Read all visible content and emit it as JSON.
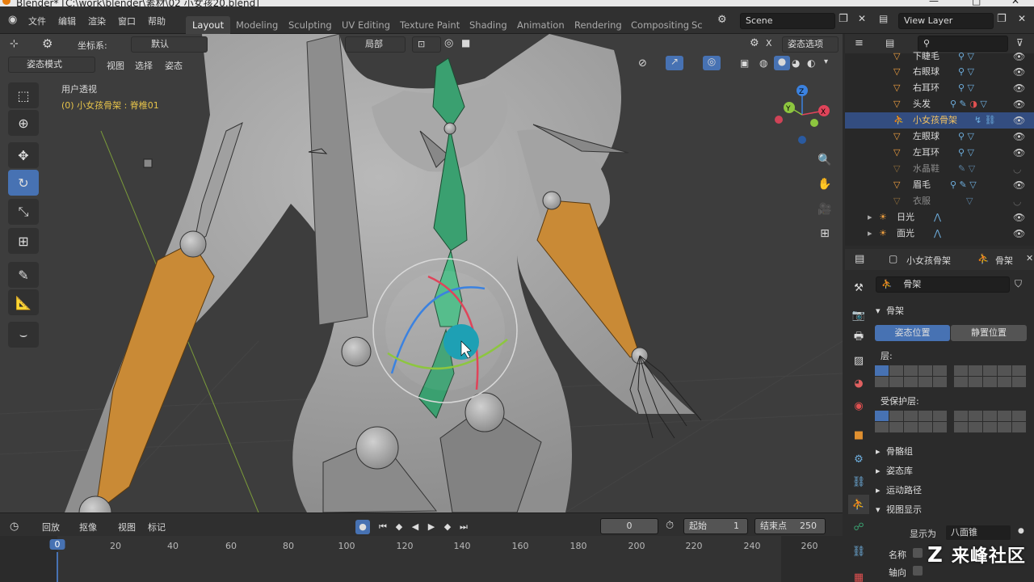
{
  "app": {
    "title": "Blender* [C:\\work\\blender\\素材\\02 小女孩20.blend]",
    "window_controls": [
      "—",
      "□",
      "✕"
    ]
  },
  "menu": [
    "文件",
    "编辑",
    "渲染",
    "窗口",
    "帮助"
  ],
  "workspaces": [
    {
      "label": "Layout",
      "active": true
    },
    {
      "label": "Modeling"
    },
    {
      "label": "Sculpting"
    },
    {
      "label": "UV Editing"
    },
    {
      "label": "Texture Paint"
    },
    {
      "label": "Shading"
    },
    {
      "label": "Animation"
    },
    {
      "label": "Rendering"
    },
    {
      "label": "Compositing"
    },
    {
      "label": "Sc"
    }
  ],
  "scene": {
    "name": "Scene",
    "view_layer": "View Layer"
  },
  "viewport": {
    "coord_label": "坐标系:",
    "coord_value": "默认",
    "pivot": "局部",
    "pose_options": "姿态选项",
    "mode": "姿态模式",
    "menus": [
      "视图",
      "选择",
      "姿态"
    ],
    "view_name": "用户透视",
    "active_info": "(0) 小女孩骨架 : 脊椎01",
    "gizmo_axes": [
      "X",
      "Y",
      "Z"
    ]
  },
  "toolbar": {
    "tools": [
      {
        "icon": "select-box-icon",
        "glyph": "⬚"
      },
      {
        "icon": "cursor-icon",
        "glyph": "⊕"
      },
      {
        "icon": "move-icon",
        "glyph": "✥"
      },
      {
        "icon": "rotate-icon",
        "glyph": "↻",
        "active": true
      },
      {
        "icon": "scale-icon",
        "glyph": "⤡"
      },
      {
        "icon": "transform-icon",
        "glyph": "⊞"
      },
      {
        "icon": "annotate-icon",
        "glyph": "✎"
      },
      {
        "icon": "measure-icon",
        "glyph": "📐"
      },
      {
        "icon": "relax-pose-icon",
        "glyph": "⌣"
      }
    ]
  },
  "nav_buttons": [
    {
      "icon": "zoom-icon",
      "glyph": "🔍"
    },
    {
      "icon": "pan-hand-icon",
      "glyph": "✋"
    },
    {
      "icon": "camera-view-icon",
      "glyph": "🎥"
    },
    {
      "icon": "ortho-grid-icon",
      "glyph": "⊞"
    }
  ],
  "outliner": {
    "search_placeholder": "",
    "items": [
      {
        "name": "下睫毛",
        "indent": 1,
        "type": "bone"
      },
      {
        "name": "右眼球",
        "indent": 1,
        "type": "bone"
      },
      {
        "name": "右耳环",
        "indent": 1,
        "type": "bone"
      },
      {
        "name": "头发",
        "indent": 1,
        "type": "bone"
      },
      {
        "name": "小女孩骨架",
        "indent": 1,
        "type": "armature",
        "selected": true
      },
      {
        "name": "左眼球",
        "indent": 1,
        "type": "bone"
      },
      {
        "name": "左耳环",
        "indent": 1,
        "type": "bone"
      },
      {
        "name": "水晶鞋",
        "indent": 1,
        "type": "bone",
        "dim": true
      },
      {
        "name": "眉毛",
        "indent": 1,
        "type": "bone"
      },
      {
        "name": "衣服",
        "indent": 1,
        "type": "bone",
        "dim": true
      },
      {
        "name": "日光",
        "indent": 0,
        "type": "light"
      },
      {
        "name": "面光",
        "indent": 0,
        "type": "light"
      }
    ]
  },
  "properties": {
    "object_name": "小女孩骨架",
    "data_tab": "骨架",
    "data_name": "骨架",
    "section_skeleton": "骨架",
    "pose_position": "姿态位置",
    "rest_position": "静置位置",
    "layers_label": "层:",
    "protected_layers_label": "受保护层:",
    "collapsed_sections": [
      "骨骼组",
      "姿态库",
      "运动路径"
    ],
    "viewport_display": "视图显示",
    "display_as_label": "显示为",
    "display_as_value": "八面锥",
    "name_label": "名称",
    "axes_label": "轴向"
  },
  "timeline": {
    "menus": [
      "回放",
      "抠像",
      "视图",
      "标记"
    ],
    "current_frame": "0",
    "start_label": "起始",
    "start_value": "1",
    "end_label": "结束点",
    "end_value": "250",
    "ticks": [
      "0",
      "20",
      "40",
      "60",
      "80",
      "100",
      "120",
      "140",
      "160",
      "180",
      "200",
      "220",
      "240",
      "260"
    ]
  },
  "watermark": "来峰社区",
  "colors": {
    "accent": "#4772b3",
    "bone_green": "#3aa070",
    "bone_orange": "#c98a36",
    "selection_row": "#334d80",
    "background": "#3d3d3d"
  }
}
